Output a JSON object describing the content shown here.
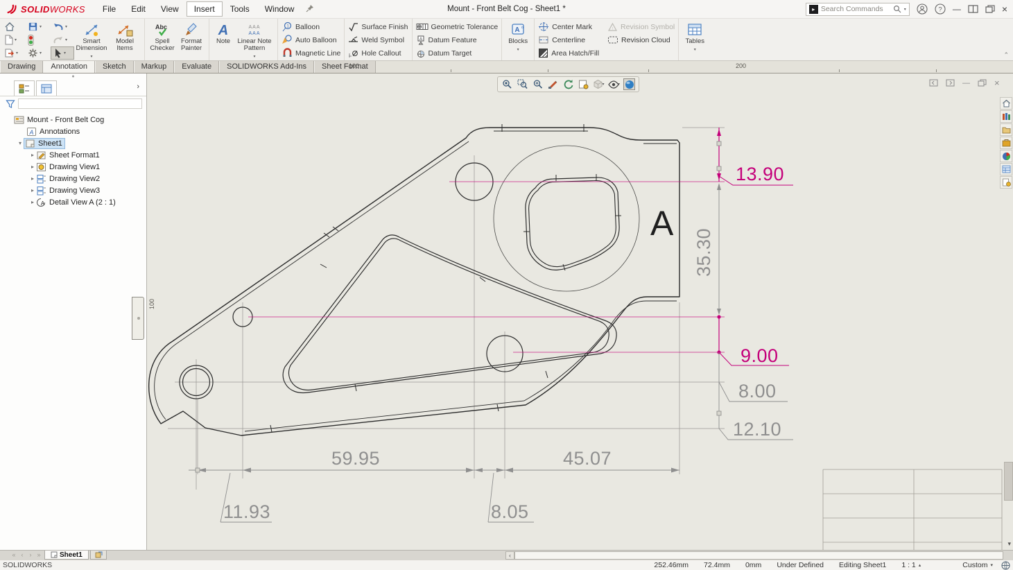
{
  "colors": {
    "accent_pink": "#C4007A",
    "dim_gray": "#8F8F8F",
    "line_dark": "#2B2B2B",
    "canvas": "#E9E8E1",
    "selection_blue": "#CDE3F6",
    "logo_red": "#D6001C",
    "sphere_blue": "#2F7FC4"
  },
  "titlebar": {
    "logo_part1": "SOLID",
    "logo_part2": "WORKS",
    "menus": [
      "File",
      "Edit",
      "View",
      "Insert",
      "Tools",
      "Window"
    ],
    "title": "Mount - Front Belt Cog - Sheet1 *",
    "search_placeholder": "Search Commands"
  },
  "ribbon": {
    "smart_dimension": "Smart Dimension",
    "model_items": "Model Items",
    "spell_checker": "Spell Checker",
    "format_painter": "Format Painter",
    "note": "Note",
    "linear_note_pattern": "Linear Note Pattern",
    "balloon": "Balloon",
    "auto_balloon": "Auto Balloon",
    "magnetic_line": "Magnetic Line",
    "surface_finish": "Surface Finish",
    "weld_symbol": "Weld Symbol",
    "hole_callout": "Hole Callout",
    "geometric_tolerance": "Geometric Tolerance",
    "datum_feature": "Datum Feature",
    "datum_target": "Datum Target",
    "blocks": "Blocks",
    "center_mark": "Center Mark",
    "centerline": "Centerline",
    "area_hatch": "Area Hatch/Fill",
    "revision_symbol": "Revision Symbol",
    "revision_cloud": "Revision Cloud",
    "tables": "Tables"
  },
  "tabs": {
    "items": [
      "Drawing",
      "Annotation",
      "Sketch",
      "Markup",
      "Evaluate",
      "SOLIDWORKS Add-Ins",
      "Sheet Format"
    ]
  },
  "ruler": {
    "top_100": "100",
    "top_200": "200",
    "left_100": "100"
  },
  "tree": {
    "root": "Mount - Front Belt Cog",
    "annotations": "Annotations",
    "sheet1": "Sheet1",
    "sheet_format1": "Sheet Format1",
    "view1": "Drawing View1",
    "view2": "Drawing View2",
    "view3": "Drawing View3",
    "detail": "Detail View A (2 : 1)"
  },
  "drawing": {
    "detail_label": "A",
    "dim_13_90": "13.90",
    "dim_35_30": "35.30",
    "dim_9_00": "9.00",
    "dim_8_00": "8.00",
    "dim_12_10": "12.10",
    "dim_59_95": "59.95",
    "dim_45_07": "45.07",
    "dim_11_93": "11.93",
    "dim_8_05": "8.05"
  },
  "sheetbar": {
    "sheet1": "Sheet1"
  },
  "statusbar": {
    "app": "SOLIDWORKS",
    "x": "252.46mm",
    "y": "72.4mm",
    "z": "0mm",
    "state": "Under Defined",
    "editing": "Editing Sheet1",
    "scale": "1 : 1",
    "units": "Custom"
  }
}
